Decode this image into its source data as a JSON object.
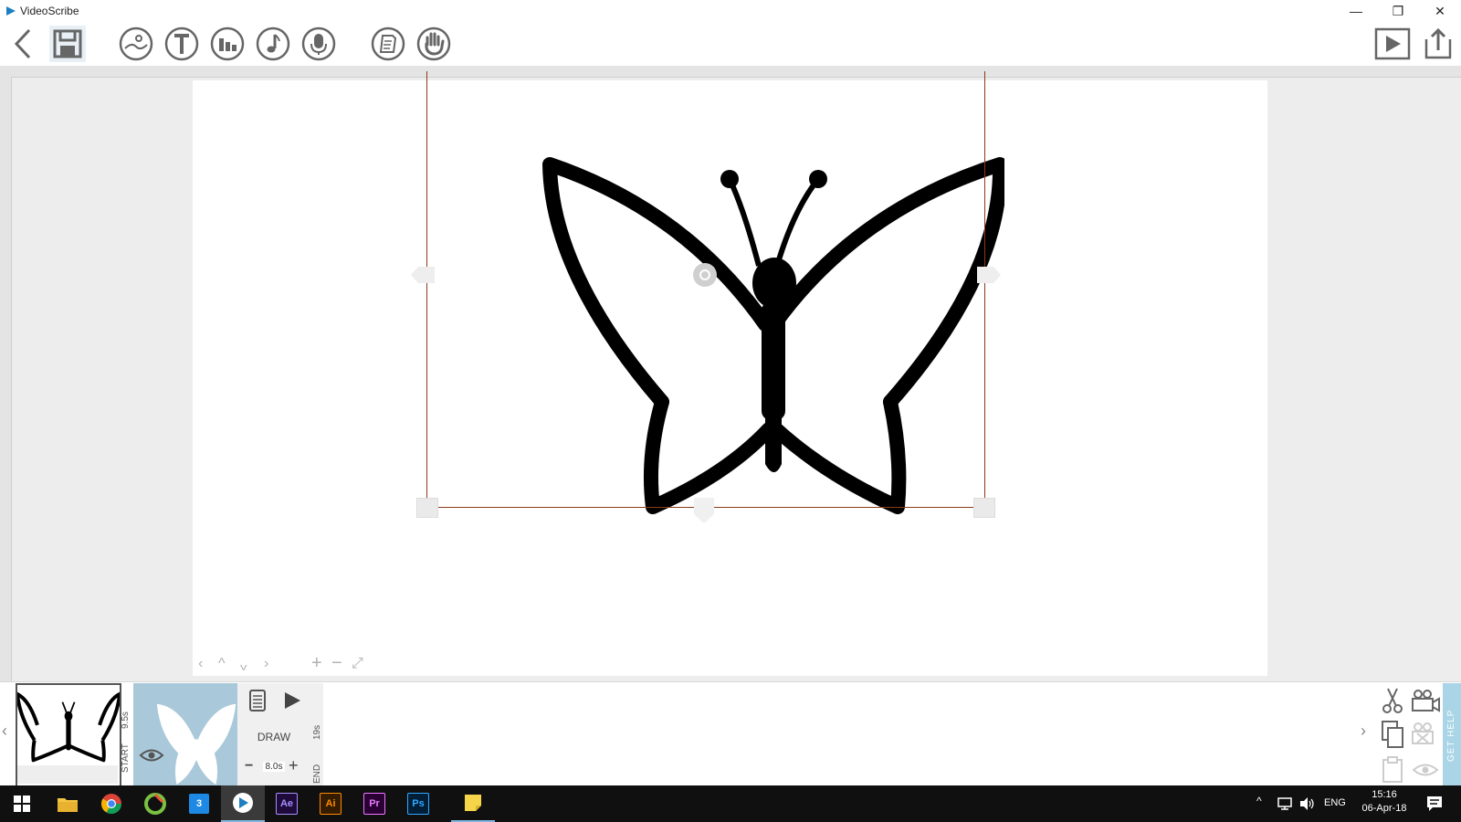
{
  "app": {
    "title": "VideoScribe"
  },
  "window_controls": {
    "minimize": "—",
    "maximize": "❐",
    "close": "✕"
  },
  "toolbar": {
    "back": "back",
    "save": "save",
    "image": "add-image",
    "text": "add-text",
    "chart": "add-chart",
    "music": "add-music",
    "voice": "record-voiceover",
    "properties": "properties",
    "hand": "choose-hand",
    "play": "play",
    "share": "share"
  },
  "timeline": {
    "element_start": "9.5s",
    "start_label": "START",
    "action_label": "DRAW",
    "duration": "8.0s",
    "element_end": "19s",
    "end_label": "END",
    "get_help": "GET HELP"
  },
  "taskbar": {
    "language": "ENG",
    "time": "15:16",
    "date": "06-Apr-18",
    "apps": [
      {
        "name": "file-explorer"
      },
      {
        "name": "chrome"
      },
      {
        "name": "ccleaner"
      },
      {
        "name": "app-3"
      },
      {
        "name": "videoscribe"
      },
      {
        "name": "after-effects",
        "label": "Ae",
        "fg": "#a58ff8",
        "bg": "#1f0a3c"
      },
      {
        "name": "illustrator",
        "label": "Ai",
        "fg": "#ff8a00",
        "bg": "#331c00"
      },
      {
        "name": "premiere",
        "label": "Pr",
        "fg": "#ea77ff",
        "bg": "#2a0034"
      },
      {
        "name": "photoshop",
        "label": "Ps",
        "fg": "#31a8ff",
        "bg": "#001e36"
      },
      {
        "name": "sticky-notes"
      }
    ]
  }
}
